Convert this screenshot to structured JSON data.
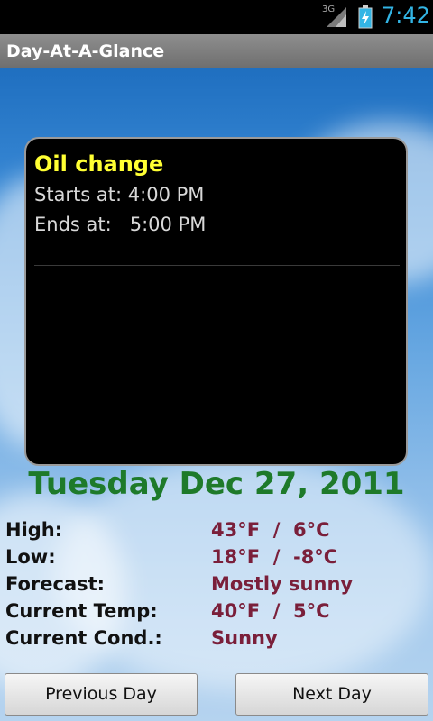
{
  "status_bar": {
    "network_label": "3G",
    "clock": "7:42",
    "icons": [
      "signal-icon",
      "battery-charging-icon"
    ]
  },
  "app": {
    "title": "Day-At-A-Glance"
  },
  "event": {
    "title": "Oil change",
    "start": "Starts at: 4:00 PM",
    "end": "Ends at:   5:00 PM"
  },
  "date": "Tuesday Dec 27, 2011",
  "weather": {
    "rows": [
      {
        "label": "High:",
        "value": "43°F  /  6°C"
      },
      {
        "label": "Low:",
        "value": "18°F  /  -8°C"
      },
      {
        "label": "Forecast:",
        "value": "Mostly sunny"
      },
      {
        "label": "Current Temp:",
        "value": "40°F  /  5°C"
      },
      {
        "label": "Current Cond.:",
        "value": "Sunny"
      }
    ]
  },
  "buttons": {
    "previous": "Previous Day",
    "next": "Next Day"
  },
  "colors": {
    "status_accent": "#33b5e5",
    "event_title": "#ffff33",
    "date": "#1e7a2a",
    "weather_value": "#7a1f3a"
  }
}
